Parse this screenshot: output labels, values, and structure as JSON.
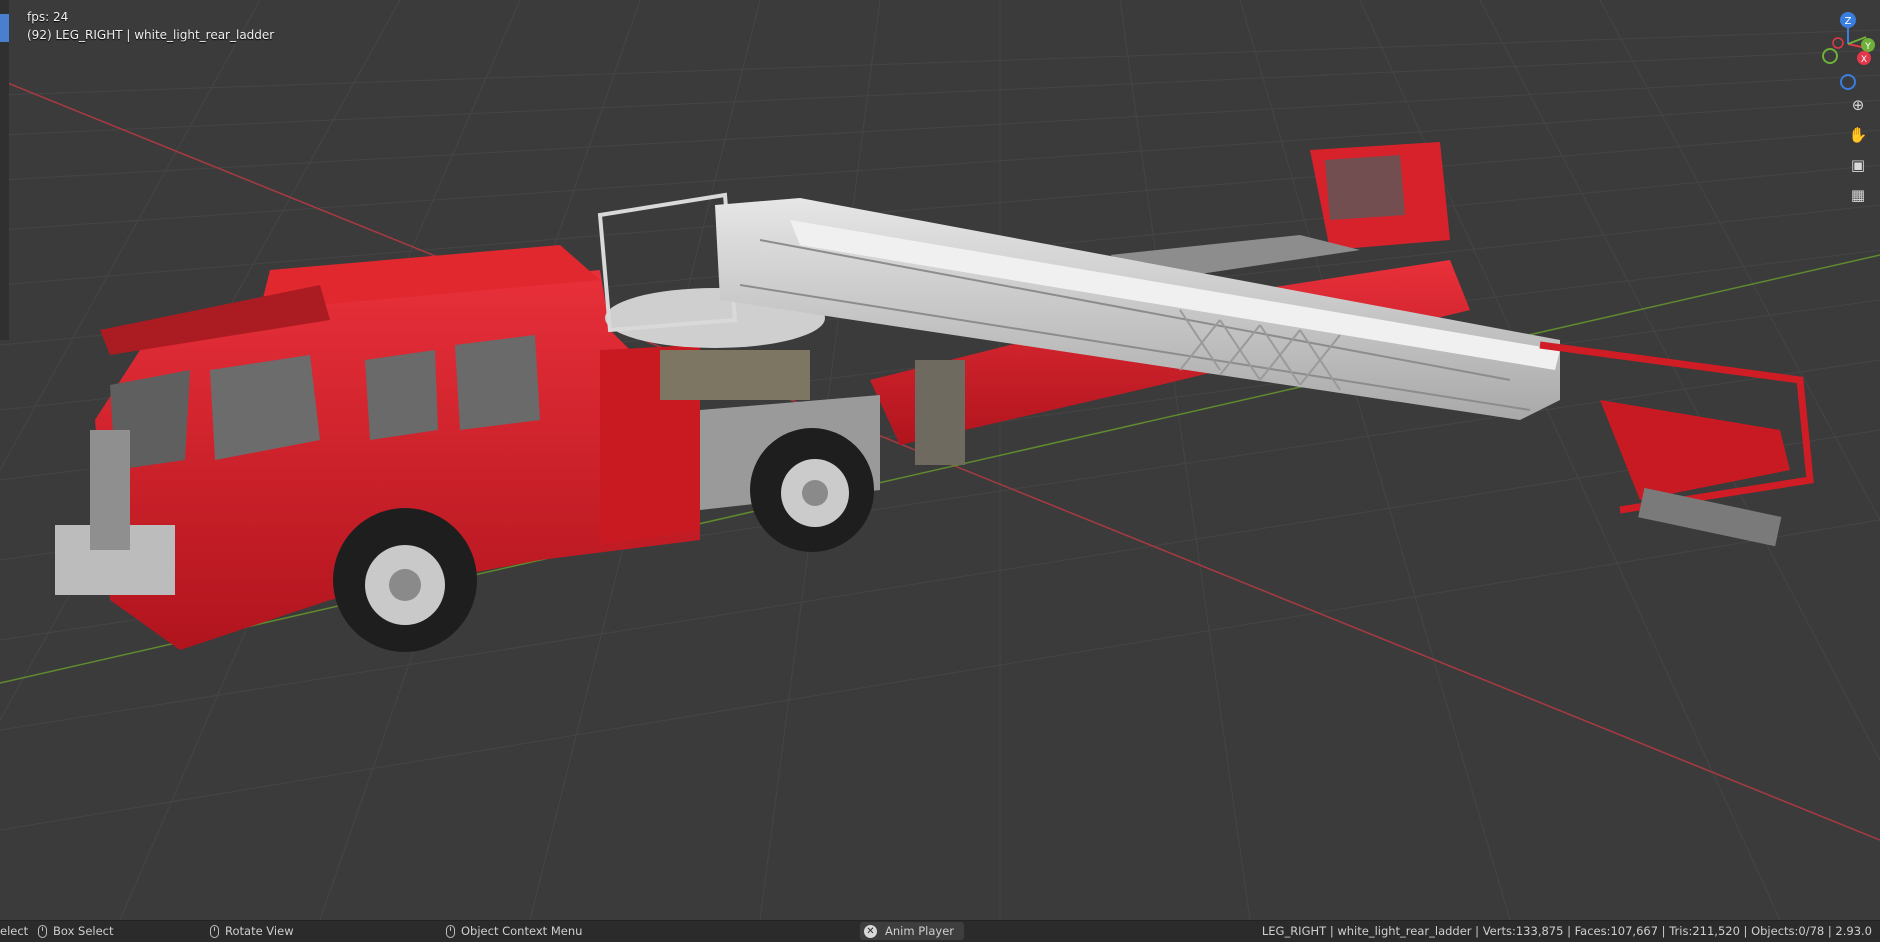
{
  "viewport": {
    "fps_text": "fps: 24",
    "active_text": "(92) LEG_RIGHT | white_light_rear_ladder"
  },
  "gizmo": {
    "z": "Z",
    "y": "Y",
    "x": "X",
    "colors": {
      "x": "#e0384a",
      "y": "#6fb03a",
      "z": "#3a7ee0"
    }
  },
  "nav_tools": [
    {
      "name": "zoom-icon",
      "glyph": "⊕"
    },
    {
      "name": "pan-hand-icon",
      "glyph": "✋"
    },
    {
      "name": "camera-icon",
      "glyph": "▣"
    },
    {
      "name": "grid-view-icon",
      "glyph": "▦"
    }
  ],
  "statusbar": {
    "select_label": "elect",
    "box_select_label": "Box Select",
    "rotate_view_label": "Rotate View",
    "context_menu_label": "Object Context Menu",
    "anim_player_label": "Anim Player",
    "stats": "LEG_RIGHT | white_light_rear_ladder | Verts:133,875 | Faces:107,667 | Tris:211,520 | Objects:0/78 | 2.93.0"
  }
}
